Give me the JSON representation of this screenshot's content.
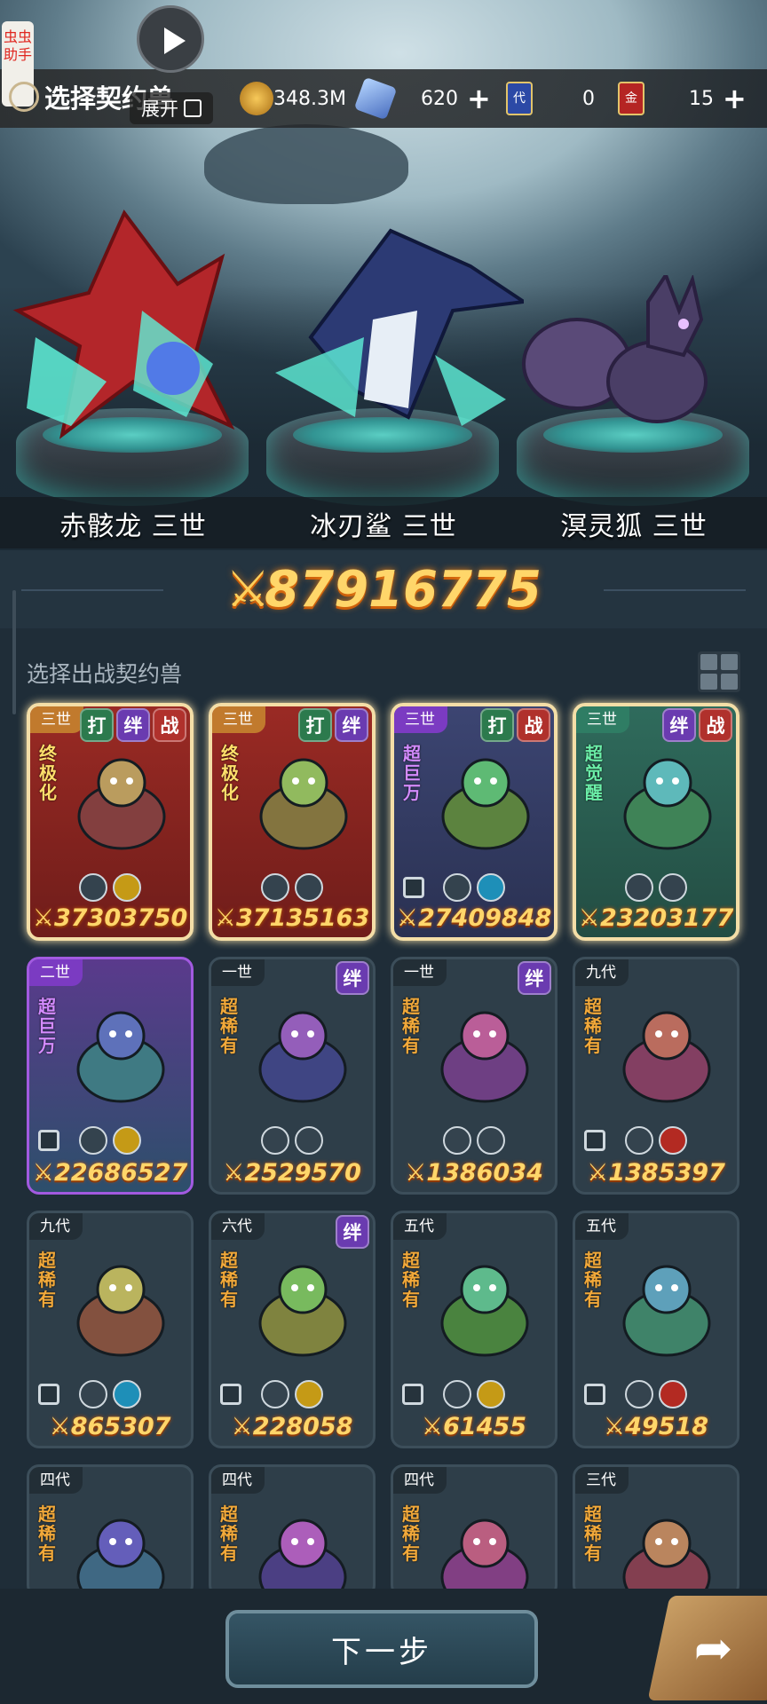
{
  "assistant_badge": "虫虫助手",
  "header": {
    "title": "选择契约兽",
    "expand_label": "展开"
  },
  "resources": [
    {
      "icon": "gold-coin-icon",
      "value": "348.3M",
      "has_plus": false
    },
    {
      "icon": "crystal-icon",
      "value": "620",
      "has_plus": true
    },
    {
      "icon": "blue-card-icon",
      "value": "0",
      "has_plus": false,
      "badge": "代"
    },
    {
      "icon": "red-card-icon",
      "value": "15",
      "has_plus": true,
      "badge": "金"
    }
  ],
  "team": [
    {
      "name": "赤骸龙 三世"
    },
    {
      "name": "冰刃鲨 三世"
    },
    {
      "name": "溟灵狐 三世"
    }
  ],
  "total_power": "87916775",
  "section_label": "选择出战契约兽",
  "tag_labels": {
    "da": "打",
    "ban": "绊",
    "zhan": "战"
  },
  "cards": [
    {
      "gen": "三世",
      "rarity": "终极化",
      "tags": [
        "da",
        "ban",
        "zhan"
      ],
      "power": "37303750",
      "selected": true,
      "locked": false,
      "icons": [
        "spiral-icon",
        "star-icon"
      ],
      "theme": "red"
    },
    {
      "gen": "三世",
      "rarity": "终极化",
      "tags": [
        "da",
        "ban"
      ],
      "power": "37135163",
      "selected": true,
      "locked": false,
      "icons": [
        "spiral-icon",
        "rock-icon"
      ],
      "theme": "red"
    },
    {
      "gen": "三世",
      "rarity": "超巨万",
      "tags": [
        "da",
        "zhan"
      ],
      "power": "27409848",
      "selected": true,
      "locked": true,
      "icons": [
        "leaf-icon",
        "water-icon"
      ],
      "theme": "blue"
    },
    {
      "gen": "三世",
      "rarity": "超觉醒",
      "tags": [
        "ban",
        "zhan"
      ],
      "power": "23203177",
      "selected": true,
      "locked": false,
      "icons": [
        "eye-icon",
        "moon-icon"
      ],
      "theme": "green"
    },
    {
      "gen": "二世",
      "rarity": "超巨万",
      "tags": [],
      "power": "22686527",
      "selected": false,
      "locked": true,
      "icons": [
        "crosshair-icon",
        "star-icon"
      ],
      "theme": "purple"
    },
    {
      "gen": "一世",
      "rarity": "超稀有",
      "tags": [
        "ban"
      ],
      "power": "2529570",
      "selected": false,
      "locked": false,
      "icons": [
        "fist-icon",
        "rock-icon"
      ],
      "theme": "plain"
    },
    {
      "gen": "一世",
      "rarity": "超稀有",
      "tags": [
        "ban"
      ],
      "power": "1386034",
      "selected": false,
      "locked": false,
      "icons": [
        "shield-icon",
        "rock-icon"
      ],
      "theme": "plain"
    },
    {
      "gen": "九代",
      "rarity": "超稀有",
      "tags": [],
      "power": "1385397",
      "selected": false,
      "locked": true,
      "icons": [
        "shield-icon",
        "fire-icon"
      ],
      "theme": "plain"
    },
    {
      "gen": "九代",
      "rarity": "超稀有",
      "tags": [],
      "power": "865307",
      "selected": false,
      "locked": true,
      "icons": [
        "shield-icon",
        "water-icon"
      ],
      "theme": "plain"
    },
    {
      "gen": "六代",
      "rarity": "超稀有",
      "tags": [
        "ban"
      ],
      "power": "228058",
      "selected": false,
      "locked": true,
      "icons": [
        "crosshair-icon",
        "star-icon"
      ],
      "theme": "plain"
    },
    {
      "gen": "五代",
      "rarity": "超稀有",
      "tags": [],
      "power": "61455",
      "selected": false,
      "locked": true,
      "icons": [
        "crosshair-icon",
        "star-icon"
      ],
      "theme": "plain"
    },
    {
      "gen": "五代",
      "rarity": "超稀有",
      "tags": [],
      "power": "49518",
      "selected": false,
      "locked": true,
      "icons": [
        "skull-icon",
        "fire-icon"
      ],
      "theme": "plain"
    },
    {
      "gen": "四代",
      "rarity": "超稀有",
      "tags": [],
      "power": "",
      "selected": false,
      "locked": false,
      "icons": [],
      "theme": "plain"
    },
    {
      "gen": "四代",
      "rarity": "超稀有",
      "tags": [],
      "power": "",
      "selected": false,
      "locked": false,
      "icons": [],
      "theme": "plain"
    },
    {
      "gen": "四代",
      "rarity": "超稀有",
      "tags": [],
      "power": "",
      "selected": false,
      "locked": false,
      "icons": [],
      "theme": "plain"
    },
    {
      "gen": "三代",
      "rarity": "超稀有",
      "tags": [],
      "power": "",
      "selected": false,
      "locked": false,
      "icons": [],
      "theme": "plain"
    }
  ],
  "next_button": "下一步",
  "colors": {
    "gold_text": "#ffd66a",
    "selected_border": "#f4dea7",
    "panel_bg": "#2e3e49"
  }
}
